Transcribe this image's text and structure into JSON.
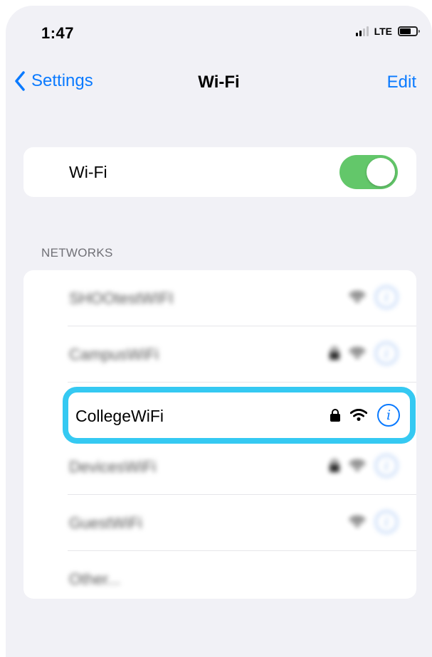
{
  "status_bar": {
    "time": "1:47",
    "network": "LTE"
  },
  "nav": {
    "back_label": "Settings",
    "title": "Wi-Fi",
    "edit_label": "Edit"
  },
  "wifi_toggle": {
    "label": "Wi-Fi",
    "on": true,
    "on_color": "#63c76a"
  },
  "networks_header": "NETWORKS",
  "networks": [
    {
      "name": "SHOOtestWIFI",
      "secured": false,
      "blurred": true
    },
    {
      "name": "CampusWiFi",
      "secured": true,
      "blurred": true
    },
    {
      "name": "CollegeWiFi",
      "secured": true,
      "blurred": false,
      "highlighted": true
    },
    {
      "name": "DevicesWiFi",
      "secured": true,
      "blurred": true
    },
    {
      "name": "GuestWiFi",
      "secured": false,
      "blurred": true
    },
    {
      "name": "Other...",
      "blurred": true
    }
  ],
  "icons": {
    "lock": "lock-icon",
    "wifi": "wifi-signal-icon",
    "info": "info-icon",
    "back": "chevron-left-icon"
  },
  "colors": {
    "accent": "#0a7aff",
    "highlight_border": "#35c9f2",
    "background": "#f1f1f6"
  },
  "info_glyph": "i"
}
